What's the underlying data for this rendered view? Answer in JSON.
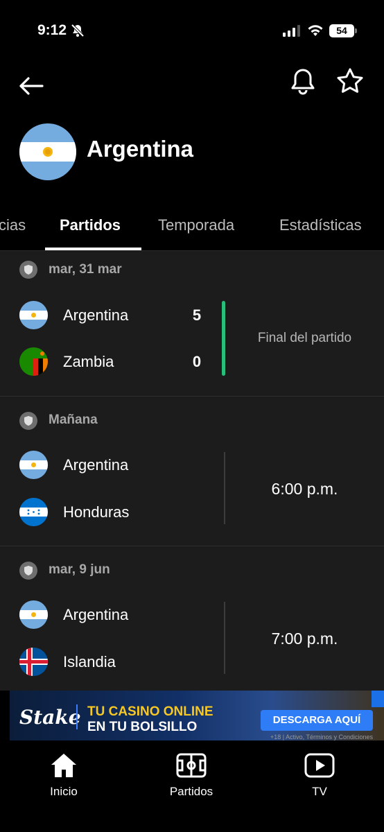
{
  "status_bar": {
    "time": "9:12",
    "battery": "54"
  },
  "header": {
    "team_name": "Argentina"
  },
  "tabs": [
    {
      "label": "cias"
    },
    {
      "label": "Partidos",
      "active": true
    },
    {
      "label": "Temporada"
    },
    {
      "label": "Estadísticas"
    }
  ],
  "matches": [
    {
      "date": "mar, 31 mar",
      "home": {
        "name": "Argentina",
        "score": "5"
      },
      "away": {
        "name": "Zambia",
        "score": "0"
      },
      "status": "Final del partido"
    },
    {
      "date": "Mañana",
      "home": {
        "name": "Argentina"
      },
      "away": {
        "name": "Honduras"
      },
      "time": "6:00 p.m."
    },
    {
      "date": "mar, 9 jun",
      "home": {
        "name": "Argentina"
      },
      "away": {
        "name": "Islandia"
      },
      "time": "7:00 p.m."
    }
  ],
  "ad": {
    "brand": "Stake",
    "line1": "TU CASINO ONLINE",
    "line2": "EN TU BOLSILLO",
    "cta": "DESCARGA AQUÍ",
    "fine_print": "+18 | Activo, Términos y Condiciones"
  },
  "bottom_nav": [
    {
      "label": "Inicio",
      "icon": "home-icon"
    },
    {
      "label": "Partidos",
      "icon": "pitch-icon"
    },
    {
      "label": "TV",
      "icon": "play-icon"
    }
  ],
  "colors": {
    "background": "#000000",
    "list_background": "#1c1c1c",
    "live_divider": "#27c07a",
    "argentina_blue": "#74acdf"
  }
}
